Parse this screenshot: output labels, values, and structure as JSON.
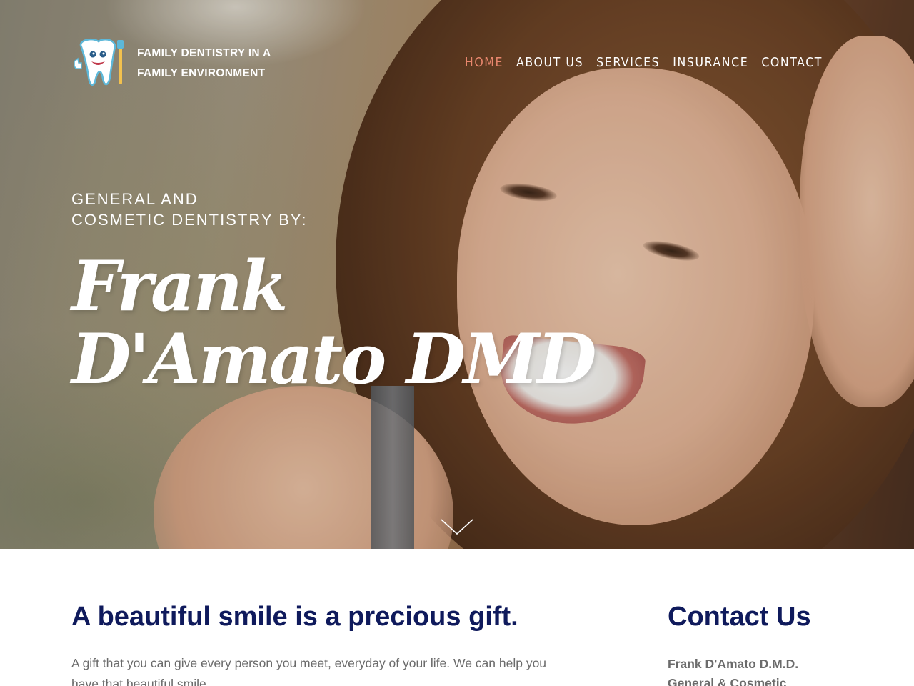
{
  "header": {
    "logo_line1": "FAMILY DENTISTRY IN A",
    "logo_line2": "FAMILY ENVIRONMENT",
    "logo_icon": "tooth-mascot-icon",
    "nav": [
      {
        "label": "HOME",
        "active": true
      },
      {
        "label": "ABOUT US",
        "active": false
      },
      {
        "label": "SERVICES",
        "active": false
      },
      {
        "label": "INSURANCE",
        "active": false
      },
      {
        "label": "CONTACT",
        "active": false
      }
    ]
  },
  "hero": {
    "subtitle_line1": "GENERAL AND",
    "subtitle_line2": "COSMETIC DENTISTRY BY:",
    "name_line1": "Frank",
    "name_line2": "D'Amato DMD",
    "scroll_icon": "chevron-down-icon"
  },
  "main": {
    "tagline": "A beautiful smile is a precious gift.",
    "intro": "A gift that you can give every person you meet, everyday of your life. We can help you have that beautiful smile."
  },
  "contact": {
    "heading": "Contact Us",
    "name": "Frank D'Amato D.M.D.",
    "line2": "General & Cosmetic"
  },
  "colors": {
    "nav_active": "#e9876e",
    "heading": "#0f1a5c",
    "body_text": "#6b6b6b"
  }
}
